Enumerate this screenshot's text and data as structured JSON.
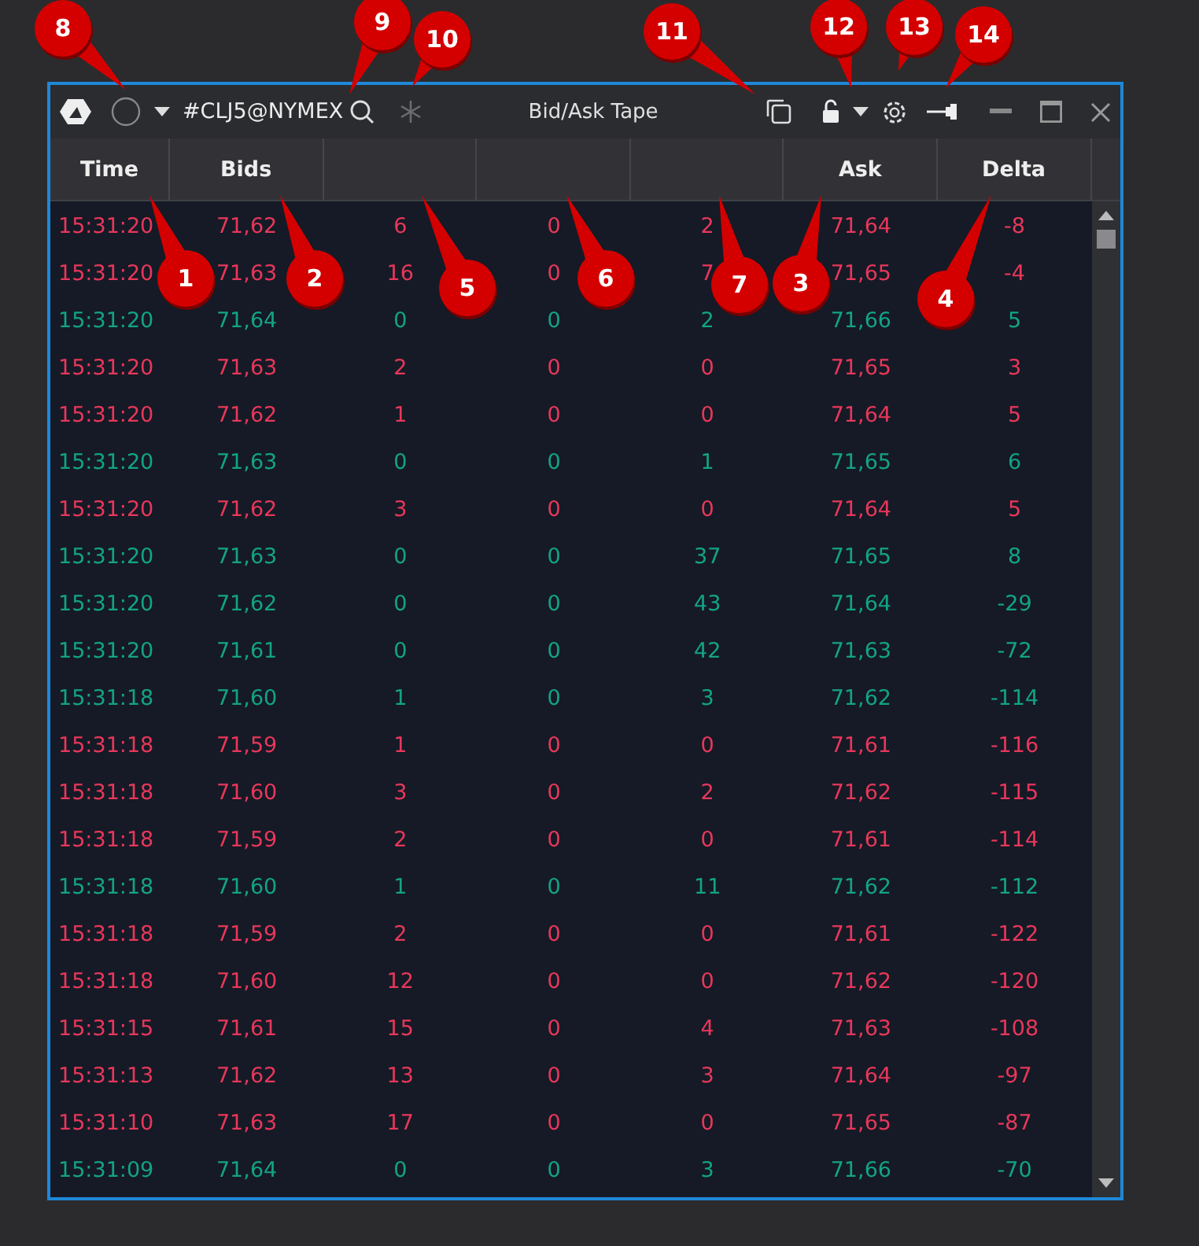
{
  "window": {
    "symbol": "#CLJ5@NYMEX",
    "title": "Bid/Ask Tape"
  },
  "columns": [
    {
      "label": "Time"
    },
    {
      "label": "Bids"
    },
    {},
    {},
    {},
    {
      "label": "Ask"
    },
    {
      "label": "Delta"
    }
  ],
  "rows": [
    {
      "color": "#e8375a",
      "cells": [
        "15:31:20",
        "71,62",
        "6",
        "0",
        "2",
        "71,64",
        "-8"
      ]
    },
    {
      "color": "#e8375a",
      "cells": [
        "15:31:20",
        "71,63",
        "16",
        "0",
        "7",
        "71,65",
        "-4"
      ]
    },
    {
      "color": "#13a385",
      "cells": [
        "15:31:20",
        "71,64",
        "0",
        "0",
        "2",
        "71,66",
        "5"
      ]
    },
    {
      "color": "#e8375a",
      "cells": [
        "15:31:20",
        "71,63",
        "2",
        "0",
        "0",
        "71,65",
        "3"
      ]
    },
    {
      "color": "#e8375a",
      "cells": [
        "15:31:20",
        "71,62",
        "1",
        "0",
        "0",
        "71,64",
        "5"
      ]
    },
    {
      "color": "#13a385",
      "cells": [
        "15:31:20",
        "71,63",
        "0",
        "0",
        "1",
        "71,65",
        "6"
      ]
    },
    {
      "color": "#e8375a",
      "cells": [
        "15:31:20",
        "71,62",
        "3",
        "0",
        "0",
        "71,64",
        "5"
      ]
    },
    {
      "color": "#13a385",
      "cells": [
        "15:31:20",
        "71,63",
        "0",
        "0",
        "37",
        "71,65",
        "8"
      ]
    },
    {
      "color": "#13a385",
      "cells": [
        "15:31:20",
        "71,62",
        "0",
        "0",
        "43",
        "71,64",
        "-29"
      ]
    },
    {
      "color": "#13a385",
      "cells": [
        "15:31:20",
        "71,61",
        "0",
        "0",
        "42",
        "71,63",
        "-72"
      ]
    },
    {
      "color": "#13a385",
      "cells": [
        "15:31:18",
        "71,60",
        "1",
        "0",
        "3",
        "71,62",
        "-114"
      ]
    },
    {
      "color": "#e8375a",
      "cells": [
        "15:31:18",
        "71,59",
        "1",
        "0",
        "0",
        "71,61",
        "-116"
      ]
    },
    {
      "color": "#e8375a",
      "cells": [
        "15:31:18",
        "71,60",
        "3",
        "0",
        "2",
        "71,62",
        "-115"
      ]
    },
    {
      "color": "#e8375a",
      "cells": [
        "15:31:18",
        "71,59",
        "2",
        "0",
        "0",
        "71,61",
        "-114"
      ]
    },
    {
      "color": "#13a385",
      "cells": [
        "15:31:18",
        "71,60",
        "1",
        "0",
        "11",
        "71,62",
        "-112"
      ]
    },
    {
      "color": "#e8375a",
      "cells": [
        "15:31:18",
        "71,59",
        "2",
        "0",
        "0",
        "71,61",
        "-122"
      ]
    },
    {
      "color": "#e8375a",
      "cells": [
        "15:31:18",
        "71,60",
        "12",
        "0",
        "0",
        "71,62",
        "-120"
      ]
    },
    {
      "color": "#e8375a",
      "cells": [
        "15:31:15",
        "71,61",
        "15",
        "0",
        "4",
        "71,63",
        "-108"
      ]
    },
    {
      "color": "#e8375a",
      "cells": [
        "15:31:13",
        "71,62",
        "13",
        "0",
        "3",
        "71,64",
        "-97"
      ]
    },
    {
      "color": "#e8375a",
      "cells": [
        "15:31:10",
        "71,63",
        "17",
        "0",
        "0",
        "71,65",
        "-87"
      ]
    },
    {
      "color": "#13a385",
      "cells": [
        "15:31:09",
        "71,64",
        "0",
        "0",
        "3",
        "71,66",
        "-70"
      ]
    }
  ],
  "callouts": [
    {
      "label": "8"
    },
    {
      "label": "9"
    },
    {
      "label": "10"
    },
    {
      "label": "11"
    },
    {
      "label": "12"
    },
    {
      "label": "13"
    },
    {
      "label": "14"
    },
    {
      "label": "1"
    },
    {
      "label": "2"
    },
    {
      "label": "5"
    },
    {
      "label": "6"
    },
    {
      "label": "7"
    },
    {
      "label": "3"
    },
    {
      "label": "4"
    }
  ]
}
